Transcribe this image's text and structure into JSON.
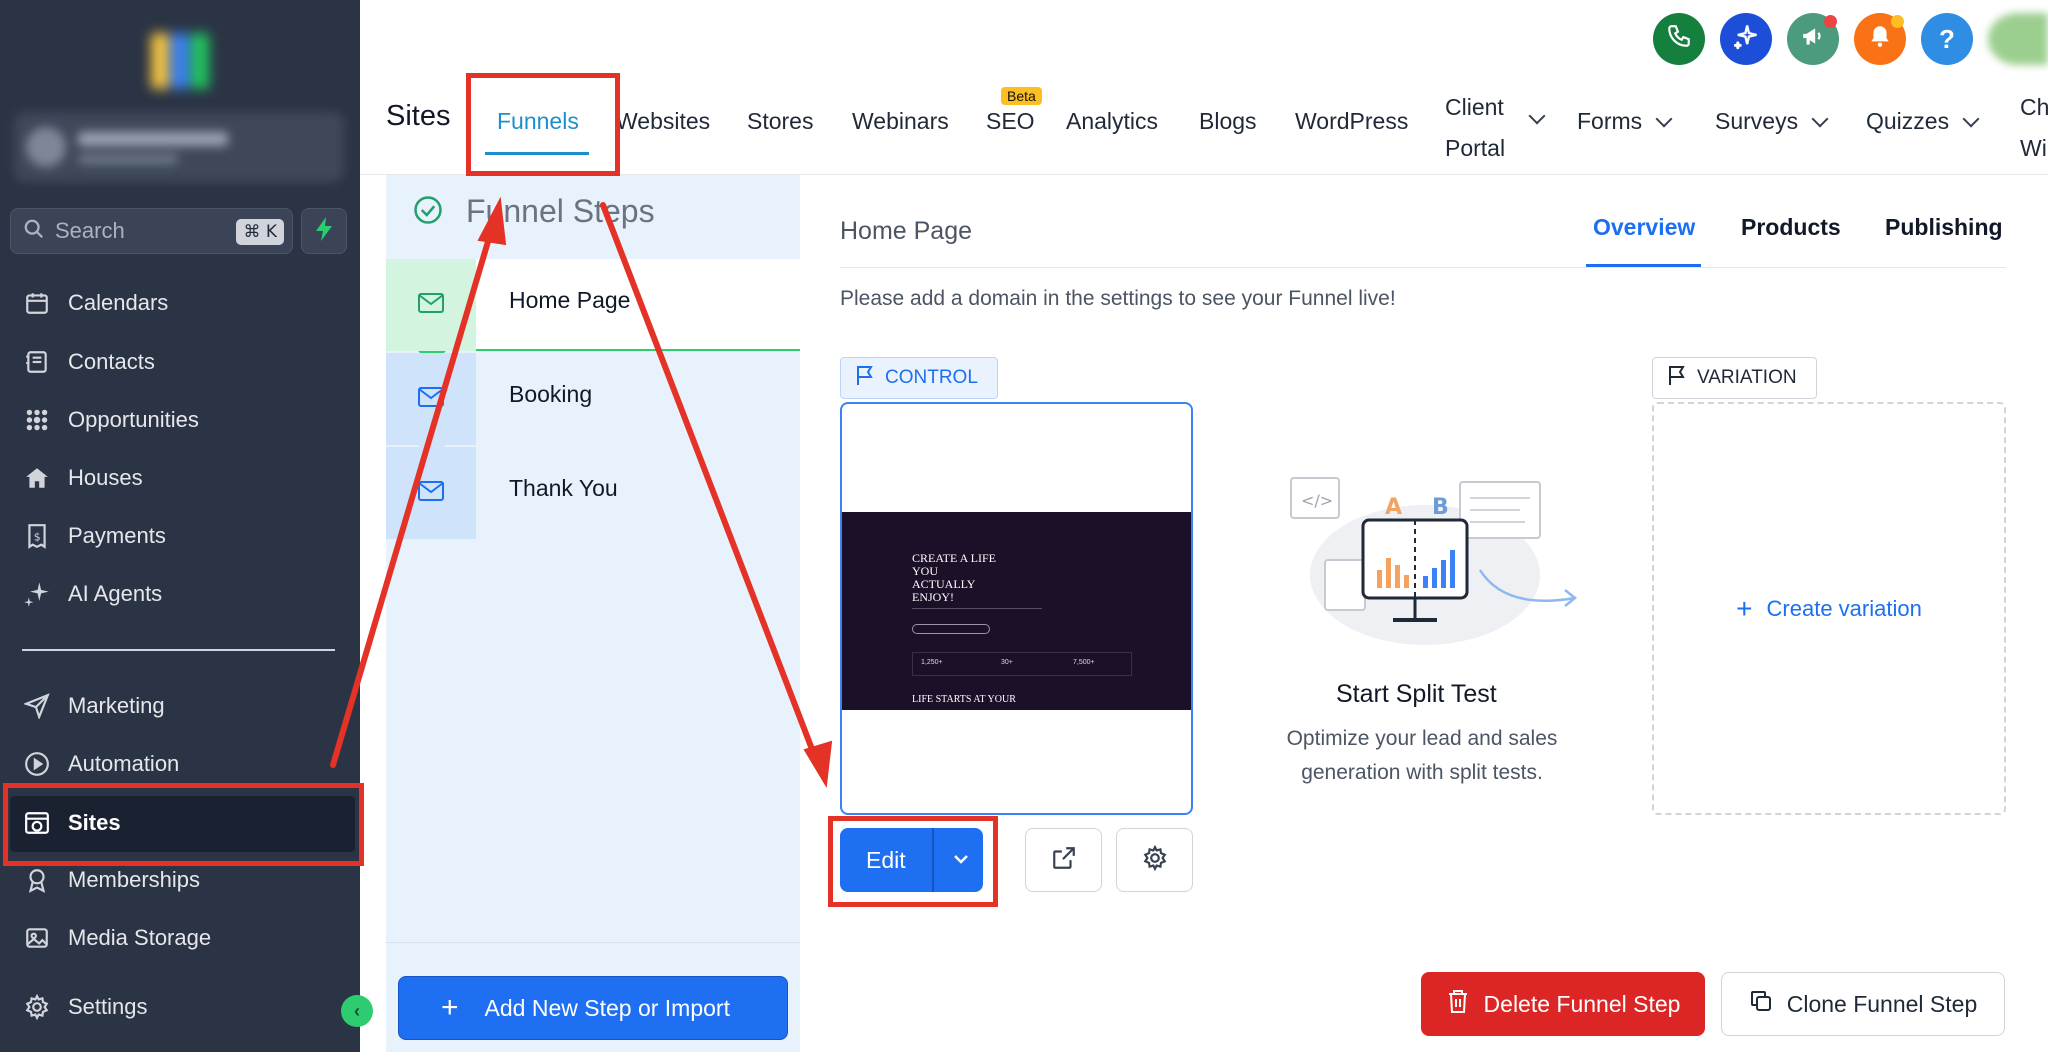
{
  "sidebar": {
    "search_placeholder": "Search",
    "search_shortcut": "⌘ K",
    "items": [
      {
        "label": "Calendars"
      },
      {
        "label": "Contacts"
      },
      {
        "label": "Opportunities"
      },
      {
        "label": "Houses"
      },
      {
        "label": "Payments"
      },
      {
        "label": "AI Agents"
      },
      {
        "label": "Marketing"
      },
      {
        "label": "Automation"
      },
      {
        "label": "Sites"
      },
      {
        "label": "Memberships"
      },
      {
        "label": "Media Storage"
      },
      {
        "label": "Settings"
      }
    ],
    "active_item": "Sites"
  },
  "header": {
    "section_title": "Sites",
    "tabs": [
      {
        "label": "Funnels"
      },
      {
        "label": "Websites"
      },
      {
        "label": "Stores"
      },
      {
        "label": "Webinars"
      },
      {
        "label": "SEO"
      },
      {
        "label": "Analytics"
      },
      {
        "label": "Blogs"
      },
      {
        "label": "WordPress"
      },
      {
        "label": "Client"
      },
      {
        "label": "Portal"
      },
      {
        "label": "Forms"
      },
      {
        "label": "Surveys"
      },
      {
        "label": "Quizzes"
      },
      {
        "label": "Ch"
      },
      {
        "label": "Wi"
      }
    ],
    "active_tab": "Funnels",
    "seo_badge": "Beta",
    "help_icon_text": "?"
  },
  "steps_panel": {
    "title": "Funnel Steps",
    "steps": [
      {
        "label": "Home Page"
      },
      {
        "label": "Booking"
      },
      {
        "label": "Thank You"
      }
    ],
    "add_button": "Add New Step or Import"
  },
  "main": {
    "page_title": "Home Page",
    "tabs": [
      {
        "label": "Overview"
      },
      {
        "label": "Products"
      },
      {
        "label": "Publishing"
      }
    ],
    "active_tab": "Overview",
    "notice": "Please add a domain in the settings to see your Funnel live!",
    "control_tag": "CONTROL",
    "variation_tag": "VARIATION",
    "preview": {
      "hero_line1": "CREATE A LIFE",
      "hero_line2": "YOU",
      "hero_line3": "ACTUALLY",
      "hero_line4": "ENJOY!",
      "stat1": "1,250+",
      "stat2": "30+",
      "stat3": "7,500+",
      "footer": "LIFE STARTS AT YOUR"
    },
    "edit_button": "Edit",
    "split_test": {
      "title": "Start Split Test",
      "description": "Optimize your lead and sales generation with split tests.",
      "label_a": "A",
      "label_b": "B"
    },
    "create_variation": "Create variation",
    "delete_button": "Delete Funnel Step",
    "clone_button": "Clone Funnel Step"
  },
  "colors": {
    "sidebar_bg": "#2b3445",
    "accent_blue": "#1f6ff2",
    "tab_active": "#1d8fd1",
    "panel_bg": "#e8f2fd",
    "danger": "#dc2626",
    "annotation_red": "#e53227",
    "phone_green": "#15803d",
    "notification_orange": "#f97316"
  }
}
